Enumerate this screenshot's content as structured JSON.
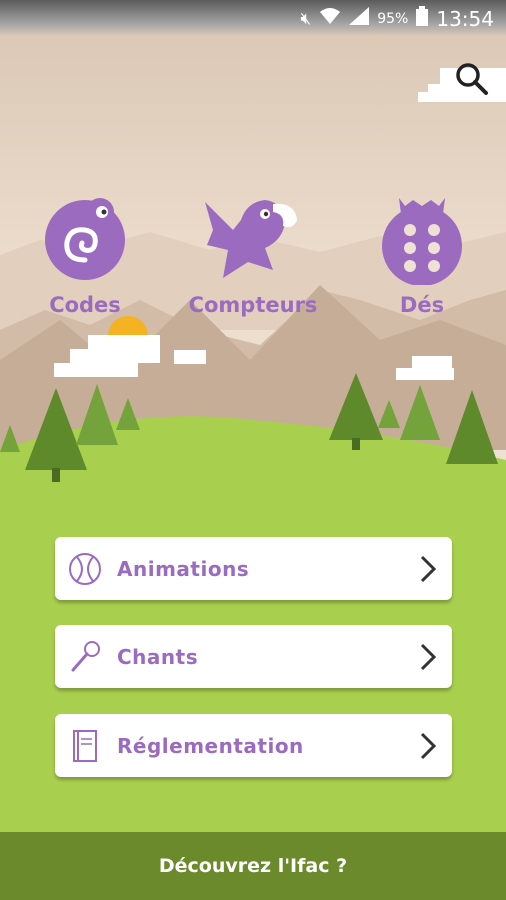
{
  "status_bar": {
    "battery": "95%",
    "time": "13:54"
  },
  "categories": [
    {
      "label": "Codes",
      "icon": "chameleon-icon"
    },
    {
      "label": "Compteurs",
      "icon": "parrot-icon"
    },
    {
      "label": "Dés",
      "icon": "ladybug-icon"
    }
  ],
  "menu": [
    {
      "label": "Animations",
      "icon": "ball-icon"
    },
    {
      "label": "Chants",
      "icon": "microphone-icon"
    },
    {
      "label": "Réglementation",
      "icon": "book-icon"
    }
  ],
  "footer": {
    "label": "Découvrez l'Ifac ?"
  },
  "colors": {
    "purple": "#9b6bbf",
    "sky": "#e9d9c8",
    "grass": "#a9cf4e",
    "footer": "#6b8a2c"
  }
}
